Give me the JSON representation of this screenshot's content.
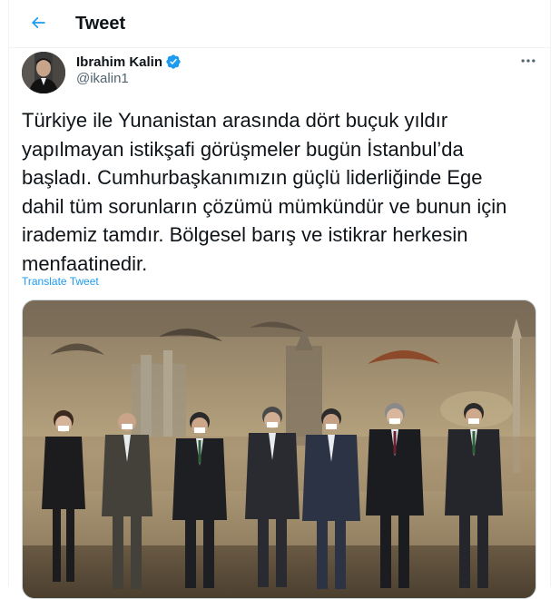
{
  "header": {
    "title": "Tweet",
    "back_icon": "arrow-left-icon"
  },
  "author": {
    "name": "Ibrahim Kalin",
    "handle": "@ikalin1",
    "verified": true,
    "verified_color": "#1d9bf0"
  },
  "tweet": {
    "text_lines": [
      "Türkiye ile Yunanistan arasında dört buçuk yıldır",
      "yapılmayan istikşafi görüşmeler bugün İstanbul’da",
      "başladı. Cumhurbaşkanımızın güçlü liderliğinde Ege",
      "dahil tüm sorunların çözümü mümkündür ve bunun için",
      "irademiz tamdır. Bölgesel barış ve istikrar herkesin",
      "menfaatinedir."
    ],
    "translate_label": "Translate Tweet"
  },
  "colors": {
    "accent": "#1d9bf0",
    "text_primary": "#0f1419",
    "text_secondary": "#536471",
    "border": "#eff3f4"
  }
}
